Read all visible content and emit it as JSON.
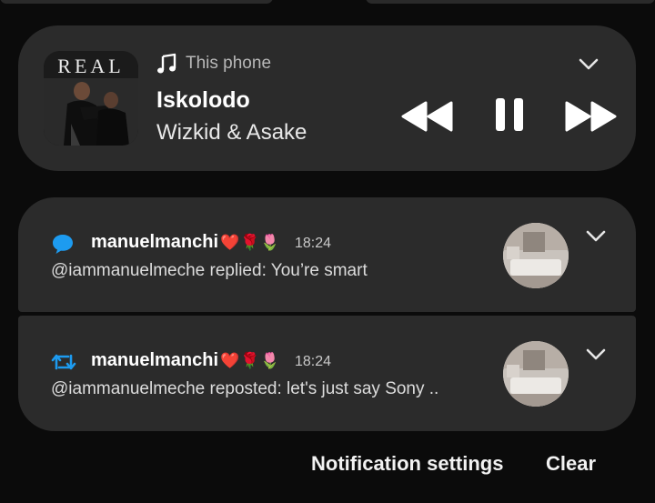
{
  "media": {
    "album_art_text": "REAL",
    "source_label": "This phone",
    "title": "Iskolodo",
    "artist": "Wizkid & Asake"
  },
  "notifications": [
    {
      "app_icon": "speech-bubble-icon",
      "sender": "manuelmanchi",
      "emojis": "❤️🌹🌷",
      "time": "18:24",
      "body": "@iammanuelmeche replied: You’re smart"
    },
    {
      "app_icon": "repost-icon",
      "sender": "manuelmanchi",
      "emojis": "❤️🌹🌷",
      "time": "18:24",
      "body": "@iammanuelmeche reposted: let's just say Sony .."
    }
  ],
  "footer": {
    "settings_label": "Notification settings",
    "clear_label": "Clear"
  },
  "colors": {
    "card_bg": "#2b2b2b",
    "page_bg": "#0b0b0b",
    "accent_blue": "#1d9bf0"
  }
}
